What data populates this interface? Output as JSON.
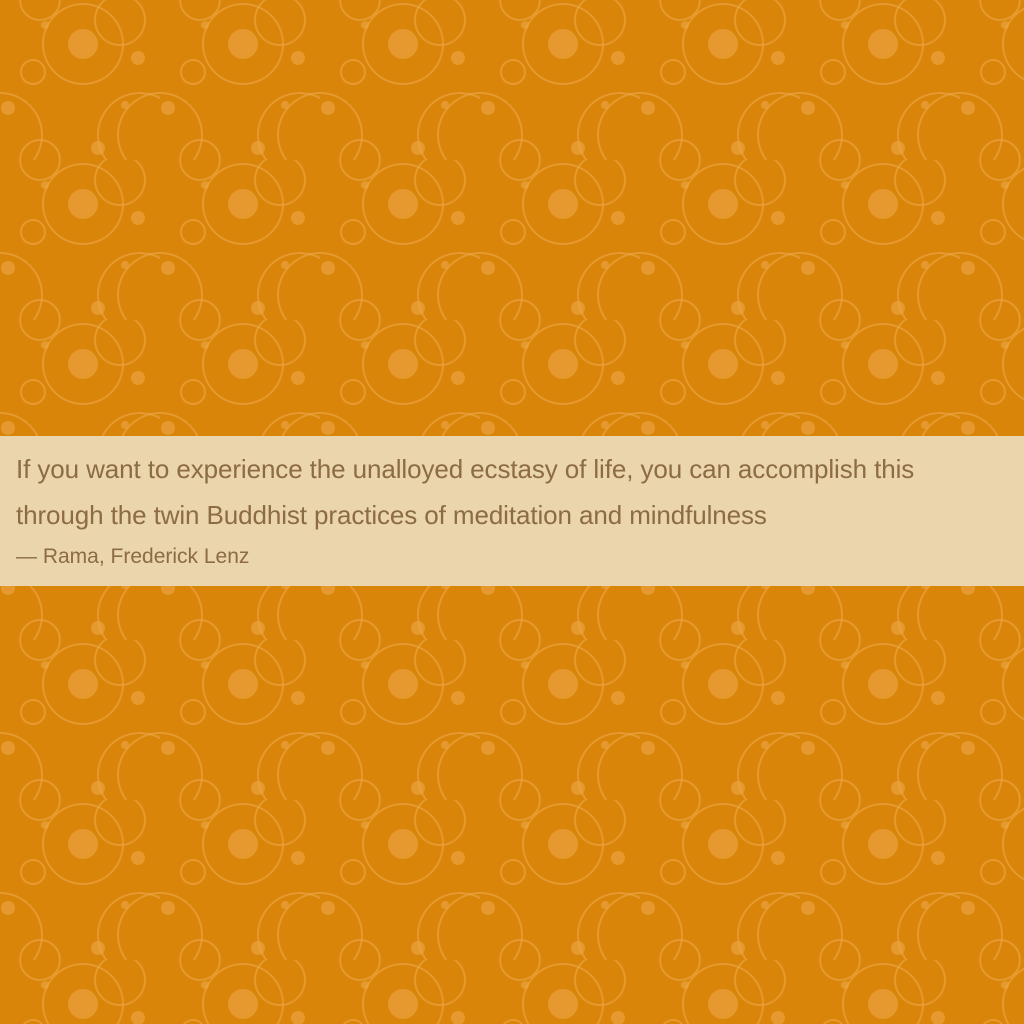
{
  "theme": {
    "background_color": "#d9850a",
    "band_color": "#ead5ad",
    "text_color": "#8c6b45",
    "pattern_color": "#efa94a"
  },
  "quote": {
    "text": "If you want to experience the unalloyed ecstasy of life, you can accomplish this through the twin Buddhist practices of meditation and mindfulness",
    "author": "— Rama, Frederick Lenz"
  }
}
